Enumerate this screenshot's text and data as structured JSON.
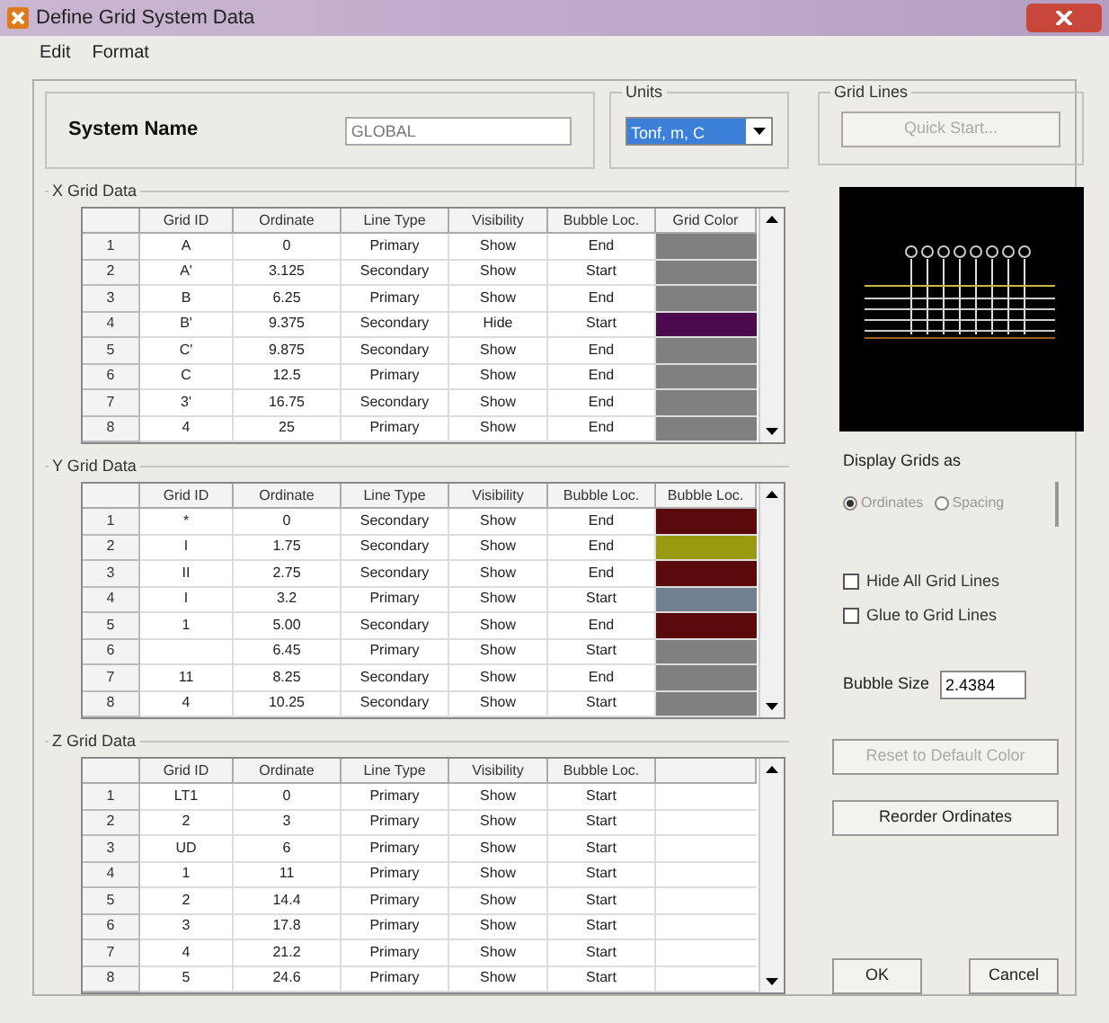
{
  "window": {
    "title": "Define Grid System Data"
  },
  "menu": [
    "Edit",
    "Format"
  ],
  "system_name": {
    "label": "System Name",
    "value": "GLOBAL"
  },
  "units": {
    "label": "Units",
    "value": "Tonf, m, C"
  },
  "quick_start": {
    "label": "Grid Lines",
    "button": "Quick Start..."
  },
  "grids": [
    {
      "title": "X Grid Data",
      "columns": [
        "Grid ID",
        "Ordinate",
        "Line Type",
        "Visibility",
        "Bubble Loc.",
        "Grid Color"
      ],
      "rows": [
        {
          "row": "1",
          "grid_id": "A",
          "ordinate": "0",
          "line_type": "Primary",
          "visibility": "Show",
          "bubble_loc": "End",
          "color": "#808080"
        },
        {
          "row": "2",
          "grid_id": "A'",
          "ordinate": "3.125",
          "line_type": "Secondary",
          "visibility": "Show",
          "bubble_loc": "Start",
          "color": "#808080"
        },
        {
          "row": "3",
          "grid_id": "B",
          "ordinate": "6.25",
          "line_type": "Primary",
          "visibility": "Show",
          "bubble_loc": "End",
          "color": "#808080"
        },
        {
          "row": "4",
          "grid_id": "B'",
          "ordinate": "9.375",
          "line_type": "Secondary",
          "visibility": "Hide",
          "bubble_loc": "Start",
          "color": "#4b0a4b"
        },
        {
          "row": "5",
          "grid_id": "C'",
          "ordinate": "9.875",
          "line_type": "Secondary",
          "visibility": "Show",
          "bubble_loc": "End",
          "color": "#808080"
        },
        {
          "row": "6",
          "grid_id": "C",
          "ordinate": "12.5",
          "line_type": "Primary",
          "visibility": "Show",
          "bubble_loc": "End",
          "color": "#808080"
        },
        {
          "row": "7",
          "grid_id": "3'",
          "ordinate": "16.75",
          "line_type": "Secondary",
          "visibility": "Show",
          "bubble_loc": "End",
          "color": "#808080"
        },
        {
          "row": "8",
          "grid_id": "4",
          "ordinate": "25",
          "line_type": "Primary",
          "visibility": "Show",
          "bubble_loc": "End",
          "color": "#808080"
        }
      ]
    },
    {
      "title": "Y Grid Data",
      "columns": [
        "Grid ID",
        "Ordinate",
        "Line Type",
        "Visibility",
        "Bubble Loc.",
        "Bubble Loc."
      ],
      "rows": [
        {
          "row": "1",
          "grid_id": "*",
          "ordinate": "0",
          "line_type": "Secondary",
          "visibility": "Show",
          "bubble_loc": "End",
          "color": "#5a0a0a"
        },
        {
          "row": "2",
          "grid_id": "I",
          "ordinate": "1.75",
          "line_type": "Secondary",
          "visibility": "Show",
          "bubble_loc": "End",
          "color": "#9a9a10"
        },
        {
          "row": "3",
          "grid_id": "II",
          "ordinate": "2.75",
          "line_type": "Secondary",
          "visibility": "Show",
          "bubble_loc": "End",
          "color": "#5a0a0a"
        },
        {
          "row": "4",
          "grid_id": "I",
          "ordinate": "3.2",
          "line_type": "Primary",
          "visibility": "Show",
          "bubble_loc": "Start",
          "color": "#708090"
        },
        {
          "row": "5",
          "grid_id": "1",
          "ordinate": "5.00",
          "line_type": "Secondary",
          "visibility": "Show",
          "bubble_loc": "End",
          "color": "#5a0a0a"
        },
        {
          "row": "6",
          "ordinate": "6.45",
          "line_type": "Primary",
          "visibility": "Show",
          "bubble_loc": "Start",
          "color": "#808080"
        },
        {
          "row": "7",
          "grid_id": "11",
          "ordinate": "8.25",
          "line_type": "Secondary",
          "visibility": "Show",
          "bubble_loc": "End",
          "color": "#808080"
        },
        {
          "row": "8",
          "grid_id": "4",
          "ordinate": "10.25",
          "line_type": "Secondary",
          "visibility": "Show",
          "bubble_loc": "Start",
          "color": "#808080"
        }
      ]
    },
    {
      "title": "Z Grid Data",
      "columns": [
        "Grid ID",
        "Ordinate",
        "Line Type",
        "Visibility",
        "Bubble Loc."
      ],
      "rows": [
        {
          "row": "1",
          "grid_id": "LT1",
          "ordinate": "0",
          "line_type": "Primary",
          "visibility": "Show",
          "bubble_loc": "Start"
        },
        {
          "row": "2",
          "grid_id": "2",
          "ordinate": "3",
          "line_type": "Primary",
          "visibility": "Show",
          "bubble_loc": "Start"
        },
        {
          "row": "3",
          "grid_id": "UD",
          "ordinate": "6",
          "line_type": "Primary",
          "visibility": "Show",
          "bubble_loc": "Start"
        },
        {
          "row": "4",
          "grid_id": "1",
          "ordinate": "11",
          "line_type": "Primary",
          "visibility": "Show",
          "bubble_loc": "Start"
        },
        {
          "row": "5",
          "grid_id": "2",
          "ordinate": "14.4",
          "line_type": "Primary",
          "visibility": "Show",
          "bubble_loc": "Start"
        },
        {
          "row": "6",
          "grid_id": "3",
          "ordinate": "17.8",
          "line_type": "Primary",
          "visibility": "Show",
          "bubble_loc": "Start"
        },
        {
          "row": "7",
          "grid_id": "4",
          "ordinate": "21.2",
          "line_type": "Primary",
          "visibility": "Show",
          "bubble_loc": "Start"
        },
        {
          "row": "8",
          "grid_id": "5",
          "ordinate": "24.6",
          "line_type": "Primary",
          "visibility": "Show",
          "bubble_loc": "Start"
        }
      ]
    }
  ],
  "display_grids": {
    "label": "Display Grids as",
    "options": [
      {
        "label": "Ordinates",
        "selected": true
      },
      {
        "label": "Spacing",
        "selected": false
      }
    ]
  },
  "checkboxes": [
    {
      "label": "Hide All Grid Lines",
      "checked": false
    },
    {
      "label": "Glue to Grid Lines",
      "checked": false
    }
  ],
  "bubble_size": {
    "label": "Bubble Size",
    "value": "2.4384"
  },
  "buttons": [
    {
      "label": "Reset to Default Color",
      "disabled": true
    },
    {
      "label": "Reorder Ordinates",
      "disabled": false
    }
  ],
  "dialog_buttons": [
    "OK",
    "Cancel"
  ]
}
